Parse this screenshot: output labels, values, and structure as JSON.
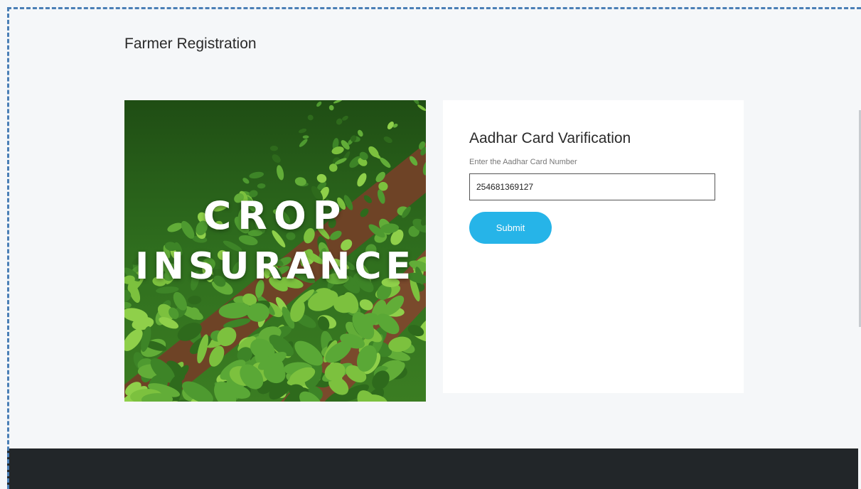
{
  "page": {
    "title": "Farmer Registration"
  },
  "hero": {
    "line1": "CROP",
    "line2": "INSURANCE",
    "colors": {
      "leaf_dark": "#2e6a1c",
      "leaf_light": "#7cc13e",
      "soil": "#7a4a2c"
    }
  },
  "verification": {
    "heading": "Aadhar Card Varification",
    "label": "Enter the Aadhar Card Number",
    "value": "254681369127",
    "submit_label": "Submit"
  },
  "colors": {
    "accent": "#26b4e8",
    "footer": "#222629",
    "page_bg": "#f5f7f9",
    "dashed_border": "#4a7fb6"
  }
}
